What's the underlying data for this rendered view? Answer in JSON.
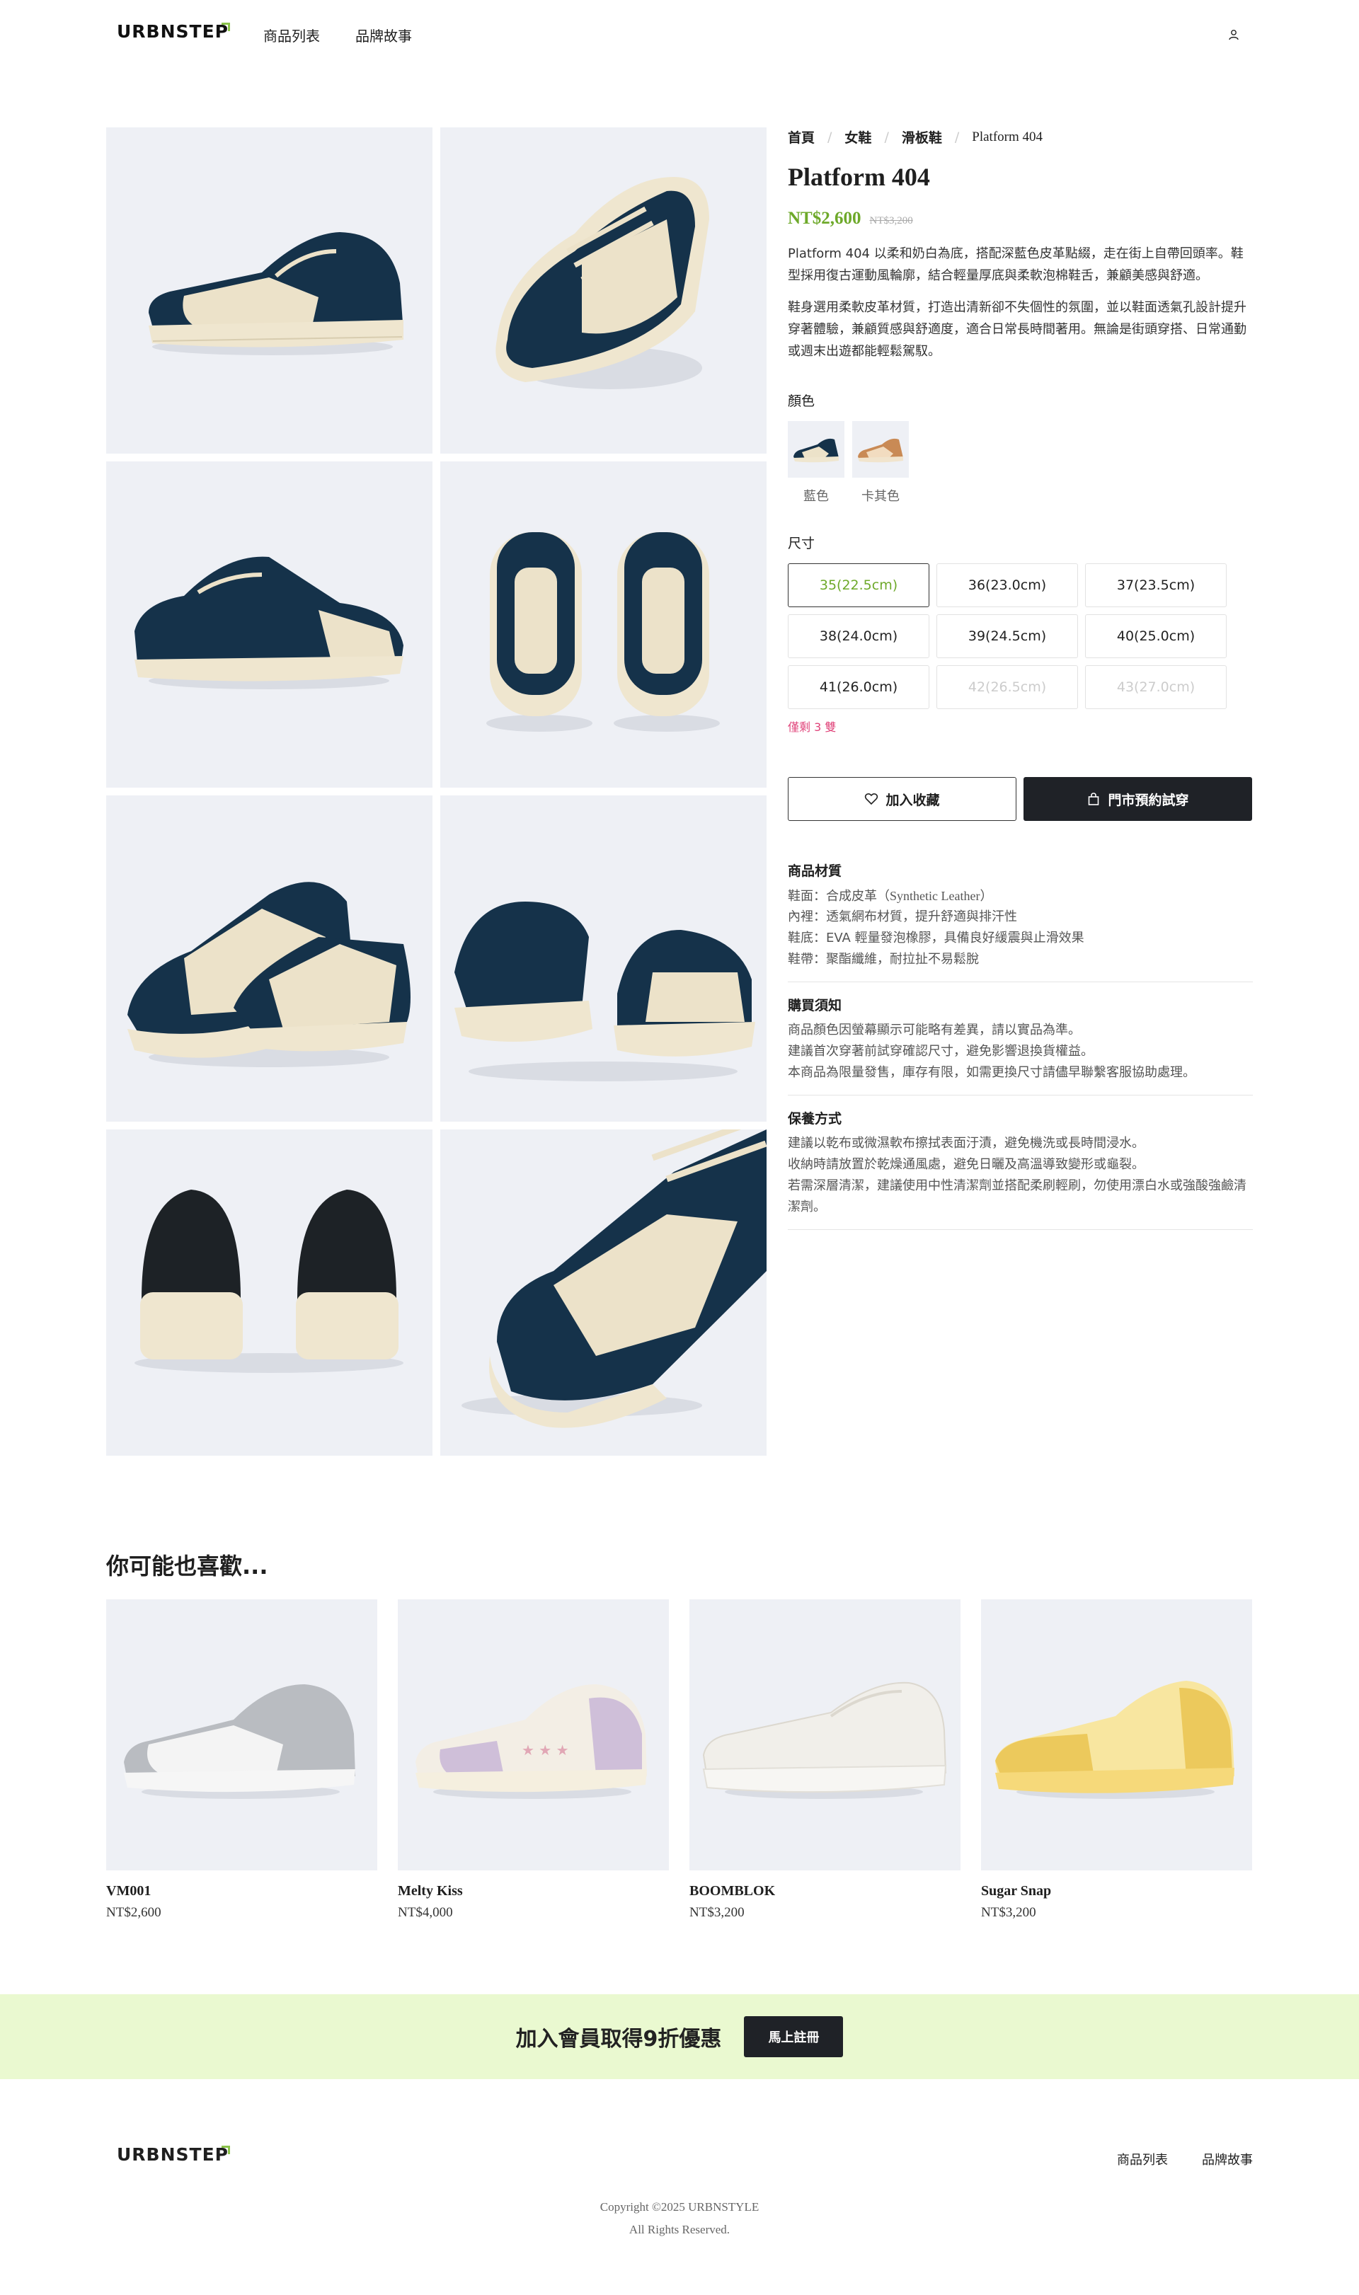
{
  "header": {
    "logo": "URBNSTEP",
    "nav": [
      "商品列表",
      "品牌故事"
    ],
    "user_icon": "user-icon"
  },
  "breadcrumb": [
    "首頁",
    "女鞋",
    "滑板鞋",
    "Platform 404"
  ],
  "product": {
    "title": "Platform 404",
    "price": "NT$2,600",
    "original_price": "NT$3,200",
    "description": [
      "Platform 404 以柔和奶白為底，搭配深藍色皮革點綴，走在街上自帶回頭率。鞋型採用復古運動風輪廓，結合輕量厚底與柔軟泡棉鞋舌，兼顧美感與舒適。",
      "鞋身選用柔軟皮革材質，打造出清新卻不失個性的氛圍，並以鞋面透氣孔設計提升穿著體驗，兼顧質感與舒適度，適合日常長時間著用。無論是街頭穿搭、日常通勤或週末出遊都能輕鬆駕馭。"
    ],
    "color_label": "顏色",
    "colors": [
      {
        "name": "藍色",
        "upper": "#15324a",
        "base": "#efe6cf"
      },
      {
        "name": "卡其色",
        "upper": "#c98a55",
        "base": "#f1e4cd"
      }
    ],
    "size_label": "尺寸",
    "sizes": [
      {
        "label": "35(22.5cm)",
        "state": "selected"
      },
      {
        "label": "36(23.0cm)",
        "state": "available"
      },
      {
        "label": "37(23.5cm)",
        "state": "available"
      },
      {
        "label": "38(24.0cm)",
        "state": "available"
      },
      {
        "label": "39(24.5cm)",
        "state": "available"
      },
      {
        "label": "40(25.0cm)",
        "state": "available"
      },
      {
        "label": "41(26.0cm)",
        "state": "available"
      },
      {
        "label": "42(26.5cm)",
        "state": "disabled"
      },
      {
        "label": "43(27.0cm)",
        "state": "disabled"
      }
    ],
    "stock_note": "僅剩 3 雙",
    "add_favorite": "加入收藏",
    "book_trial": "門市預約試穿",
    "sections": [
      {
        "title": "商品材質",
        "lines": [
          "鞋面：合成皮革（Synthetic Leather）",
          "內裡：透氣網布材質，提升舒適與排汗性",
          "鞋底：EVA 輕量發泡橡膠，具備良好緩震與止滑效果",
          "鞋帶：聚酯纖維，耐拉扯不易鬆脫"
        ]
      },
      {
        "title": "購買須知",
        "lines": [
          "商品顏色因螢幕顯示可能略有差異，請以實品為準。",
          "建議首次穿著前試穿確認尺寸，避免影響退換貨權益。",
          "本商品為限量發售，庫存有限，如需更換尺寸請儘早聯繫客服協助處理。"
        ]
      },
      {
        "title": "保養方式",
        "lines": [
          "建議以乾布或微濕軟布擦拭表面汙漬，避免機洗或長時間浸水。",
          "收納時請放置於乾燥通風處，避免日曬及高溫導致變形或龜裂。",
          "若需深層清潔，建議使用中性清潔劑並搭配柔刷輕刷，勿使用漂白水或強酸強鹼清潔劑。"
        ]
      }
    ]
  },
  "recommendations": {
    "title": "你可能也喜歡...",
    "items": [
      {
        "name": "VM001",
        "price": "NT$2,600",
        "upper": "#b9bcc1",
        "base": "#f6f6f6"
      },
      {
        "name": "Melty Kiss",
        "price": "NT$4,000",
        "upper": "#cfbfd9",
        "base": "#f3eee5"
      },
      {
        "name": "BOOMBLOK",
        "price": "NT$3,200",
        "upper": "#f1efea",
        "base": "#f7f6f3"
      },
      {
        "name": "Sugar Snap",
        "price": "NT$3,200",
        "upper": "#ecc95c",
        "base": "#f8e6a0"
      }
    ]
  },
  "banner": {
    "text": "加入會員取得9折優惠",
    "button": "馬上註冊"
  },
  "footer": {
    "logo": "URBNSTEP",
    "nav": [
      "商品列表",
      "品牌故事"
    ],
    "copyright": "Copyright ©2025 URBNSTYLE",
    "rights": "All Rights Reserved."
  },
  "colors": {
    "accent_green": "#6ea92a",
    "stock_pink": "#e0457b",
    "dark_button": "#1f2227",
    "banner_bg": "#eaf9d0",
    "image_bg": "#eef0f5"
  }
}
